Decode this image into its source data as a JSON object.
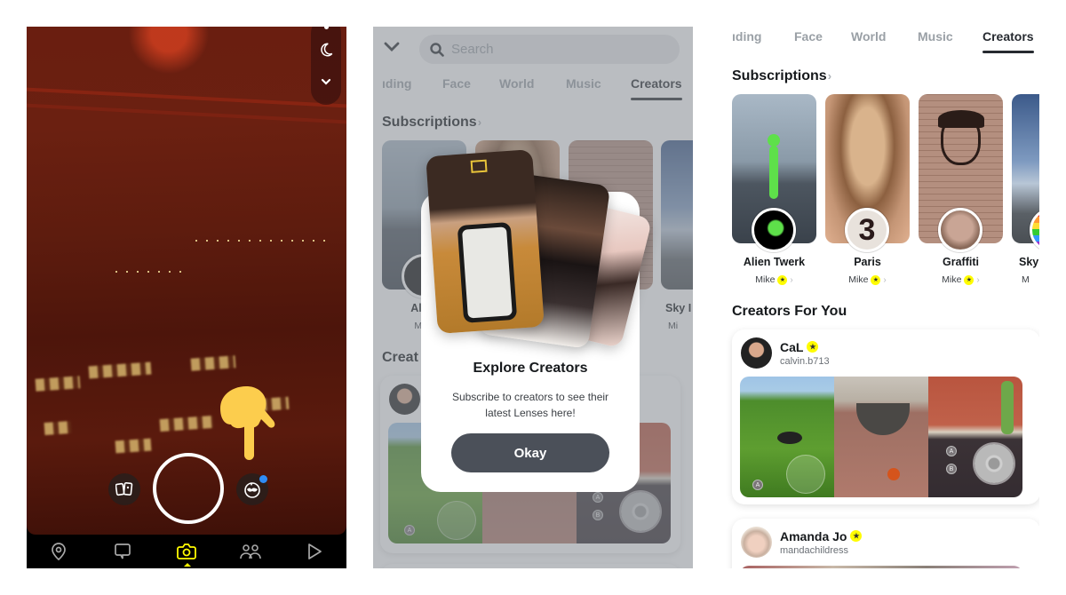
{
  "camera": {
    "side_controls": [
      "flash-indicator",
      "night-mode-icon",
      "chevron-down-icon"
    ],
    "left_button_icon": "memories-cards-icon",
    "right_button_icon": "lens-explorer-icon",
    "lens_notification_color": "#2f8cf5",
    "pointer_color": "#fccd4d",
    "nav": [
      {
        "icon": "map-pin-icon",
        "label": "Map"
      },
      {
        "icon": "chat-icon",
        "label": "Chat"
      },
      {
        "icon": "camera-icon",
        "label": "Camera",
        "active": true
      },
      {
        "icon": "friends-icon",
        "label": "Stories"
      },
      {
        "icon": "play-icon",
        "label": "Spotlight"
      }
    ],
    "active_color": "#fffc00"
  },
  "browser": {
    "search_placeholder": "Search",
    "tabs": [
      "ıding",
      "Face",
      "World",
      "Music",
      "Creators"
    ],
    "active_tab": "Creators",
    "subscriptions_title": "Subscriptions",
    "subscriptions_chevron": "›",
    "lenses": [
      {
        "name": "Alien Twerk",
        "author": "Mike"
      },
      {
        "name": "Paris",
        "author": "Mike"
      },
      {
        "name": "Graffiti",
        "author": "Mike"
      },
      {
        "name": "Sky",
        "author": "M"
      }
    ],
    "lenses_obscured": [
      {
        "name": "Alien",
        "author": "Mike"
      },
      {
        "name": "Sky I",
        "author": "Mi"
      }
    ],
    "creators_title": "Creators For You",
    "creators_title_obscured": "Creat",
    "star_glyph": "★",
    "arrow_glyph": "›",
    "paris_icon_text": "3",
    "creators": [
      {
        "name": "CaL",
        "handle": "calvin.b713",
        "lens_thumbs": [
          "dog-on-grass",
          "halloween-bowl",
          "zombie-joystick"
        ]
      },
      {
        "name": "Amanda Jo",
        "handle": "mandachildress"
      }
    ],
    "game_buttons": {
      "a": "A",
      "b": "B"
    }
  },
  "modal": {
    "title": "Explore Creators",
    "body": "Subscribe to creators to see their latest Lenses here!",
    "button": "Okay"
  }
}
